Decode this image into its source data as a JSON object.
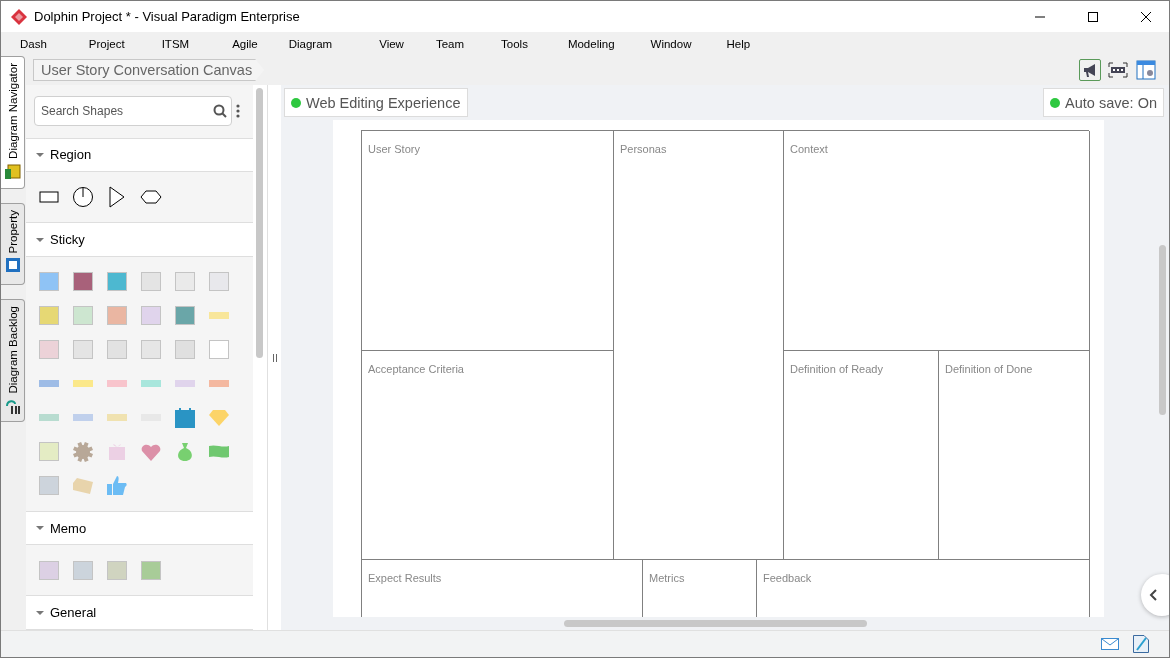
{
  "window": {
    "title": "Dolphin Project * - Visual Paradigm Enterprise"
  },
  "menu": [
    "Dash",
    "Project",
    "ITSM",
    "Agile",
    "Diagram",
    "View",
    "Team",
    "Tools",
    "Modeling",
    "Window",
    "Help"
  ],
  "side_tabs": [
    {
      "label": "Diagram Navigator",
      "selected": true
    },
    {
      "label": "Property",
      "selected": false
    },
    {
      "label": "Diagram Backlog",
      "selected": false
    }
  ],
  "breadcrumb": "User Story Conversation Canvas",
  "palette": {
    "search": {
      "placeholder": "Search Shapes"
    },
    "sections": [
      {
        "title": "Region",
        "expanded": true,
        "items": [
          {
            "kind": "rect"
          },
          {
            "kind": "circle"
          },
          {
            "kind": "triangle"
          },
          {
            "kind": "hexagon"
          }
        ]
      },
      {
        "title": "Sticky",
        "expanded": true,
        "items": [
          {
            "kind": "note",
            "color": "#8fc3f5"
          },
          {
            "kind": "note",
            "color": "#a8617a"
          },
          {
            "kind": "note",
            "color": "#4db8d0"
          },
          {
            "kind": "note",
            "color": "#e4e4e4"
          },
          {
            "kind": "note",
            "color": "#eaeaea"
          },
          {
            "kind": "note",
            "color": "#e8e8ec"
          },
          {
            "kind": "note",
            "color": "#e6d874"
          },
          {
            "kind": "note",
            "color": "#cde6d0"
          },
          {
            "kind": "note",
            "color": "#eab6a2"
          },
          {
            "kind": "note",
            "color": "#e0d4ec"
          },
          {
            "kind": "note",
            "color": "#6aa6a8"
          },
          {
            "kind": "tape",
            "color": "#f8e69a"
          },
          {
            "kind": "note",
            "color": "#ecd2d8"
          },
          {
            "kind": "note",
            "color": "#e4e4e4"
          },
          {
            "kind": "note",
            "color": "#e2e2e2"
          },
          {
            "kind": "note",
            "color": "#e6e6e6"
          },
          {
            "kind": "note",
            "color": "#e0e0e0"
          },
          {
            "kind": "note",
            "color": "#ffffff"
          },
          {
            "kind": "tape",
            "color": "#9ebce6"
          },
          {
            "kind": "tape",
            "color": "#fbe88a"
          },
          {
            "kind": "tape",
            "color": "#f8c4cc"
          },
          {
            "kind": "tape",
            "color": "#a8e6dc"
          },
          {
            "kind": "tape",
            "color": "#e0d4ec"
          },
          {
            "kind": "tape",
            "color": "#f4b8a0"
          },
          {
            "kind": "tape",
            "color": "#b8dcd0"
          },
          {
            "kind": "tape",
            "color": "#c0d0ec"
          },
          {
            "kind": "tape",
            "color": "#f0e2b0"
          },
          {
            "kind": "tape",
            "color": "#e8e8e8"
          },
          {
            "kind": "calendar",
            "color": "#2a94c4"
          },
          {
            "kind": "gem",
            "color": "#fcd468"
          },
          {
            "kind": "note",
            "color": "#e4ecc4"
          },
          {
            "kind": "gear",
            "color": "#b8a898"
          },
          {
            "kind": "gift",
            "color": "#ecd0e4"
          },
          {
            "kind": "heart",
            "color": "#dc90a8"
          },
          {
            "kind": "bag",
            "color": "#78d070"
          },
          {
            "kind": "flag",
            "color": "#70c870"
          },
          {
            "kind": "note",
            "color": "#cdd4dc"
          },
          {
            "kind": "tag",
            "color": "#e8d4ac"
          },
          {
            "kind": "thumb",
            "color": "#6cbcf4"
          }
        ]
      },
      {
        "title": "Memo",
        "expanded": true,
        "items": [
          {
            "kind": "note",
            "color": "#dcd0e4"
          },
          {
            "kind": "note",
            "color": "#ccd4dc"
          },
          {
            "kind": "note",
            "color": "#d0d4c0"
          },
          {
            "kind": "note",
            "color": "#a8cc98"
          }
        ]
      },
      {
        "title": "General",
        "expanded": true
      }
    ]
  },
  "canvas": {
    "badge": "Web Editing Experience",
    "autosave": "Auto save: On",
    "cells": [
      {
        "label": "User Story"
      },
      {
        "label": "Personas"
      },
      {
        "label": "Context"
      },
      {
        "label": "Acceptance Criteria"
      },
      {
        "label": "Definition of Ready"
      },
      {
        "label": "Definition of Done"
      },
      {
        "label": "Expect Results"
      },
      {
        "label": "Metrics"
      },
      {
        "label": "Feedback"
      }
    ]
  }
}
